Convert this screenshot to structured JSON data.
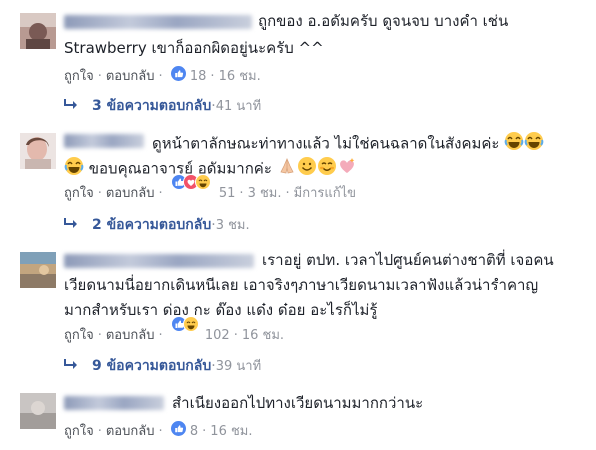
{
  "comments": [
    {
      "lines": [
        "ถูกของ อ.อดัมครับ ดูจนจบ บางคำ เช่น",
        "Strawberry เขาก็ออกผิดอยู่นะครับ ^^"
      ],
      "like_label": "ถูกใจ",
      "reply_label": "ตอบกลับ",
      "reaction_count": "18",
      "time": "16 ชม.",
      "replies": {
        "count": "3 ข้อความตอบกลับ",
        "time": "41 นาที"
      },
      "avatar_color": "#9c7b72"
    },
    {
      "lines": [
        "ดูหน้าตาลักษณะท่าทางแล้ว ไม่ใช่คนฉลาดในสังคมค่ะ",
        "ขอบคุณอาจารย์ อดัมมากค่ะ"
      ],
      "like_label": "ถูกใจ",
      "reply_label": "ตอบกลับ",
      "reaction_count": "51",
      "time": "3 ชม.",
      "edited": "มีการแก้ไข",
      "replies": {
        "count": "2 ข้อความตอบกลับ",
        "time": "3 ชม."
      },
      "avatar_color": "#d7c8c4"
    },
    {
      "lines": [
        "เราอยู่ ตปท. เวลาไปศูนย์คนต่างชาติที่ เจอคน",
        "เวียดนามนี่อยากเดินหนีเลย เอาจริงๆภาษาเวียดนามเวลาฟังแล้วน่ารำคาญ",
        "มากสำหรับเรา ด่อง กะ ด๊อง แด๋ง ด๋อย อะไรก็ไม่รู้"
      ],
      "like_label": "ถูกใจ",
      "reply_label": "ตอบกลับ",
      "reaction_count": "102",
      "time": "16 ชม.",
      "replies": {
        "count": "9 ข้อความตอบกลับ",
        "time": "39 นาที"
      },
      "avatar_color": "#8fa3b0"
    },
    {
      "lines": [
        "สำเนียงออกไปทางเวียดนามมากกว่านะ"
      ],
      "like_label": "ถูกใจ",
      "reply_label": "ตอบกลับ",
      "reaction_count": "8",
      "time": "16 ชม.",
      "avatar_color": "#b9b5b3"
    }
  ],
  "colors": {
    "link": "#365899",
    "meta": "#90949c",
    "text": "#1d2129",
    "like_blue": "#4e86f1"
  }
}
